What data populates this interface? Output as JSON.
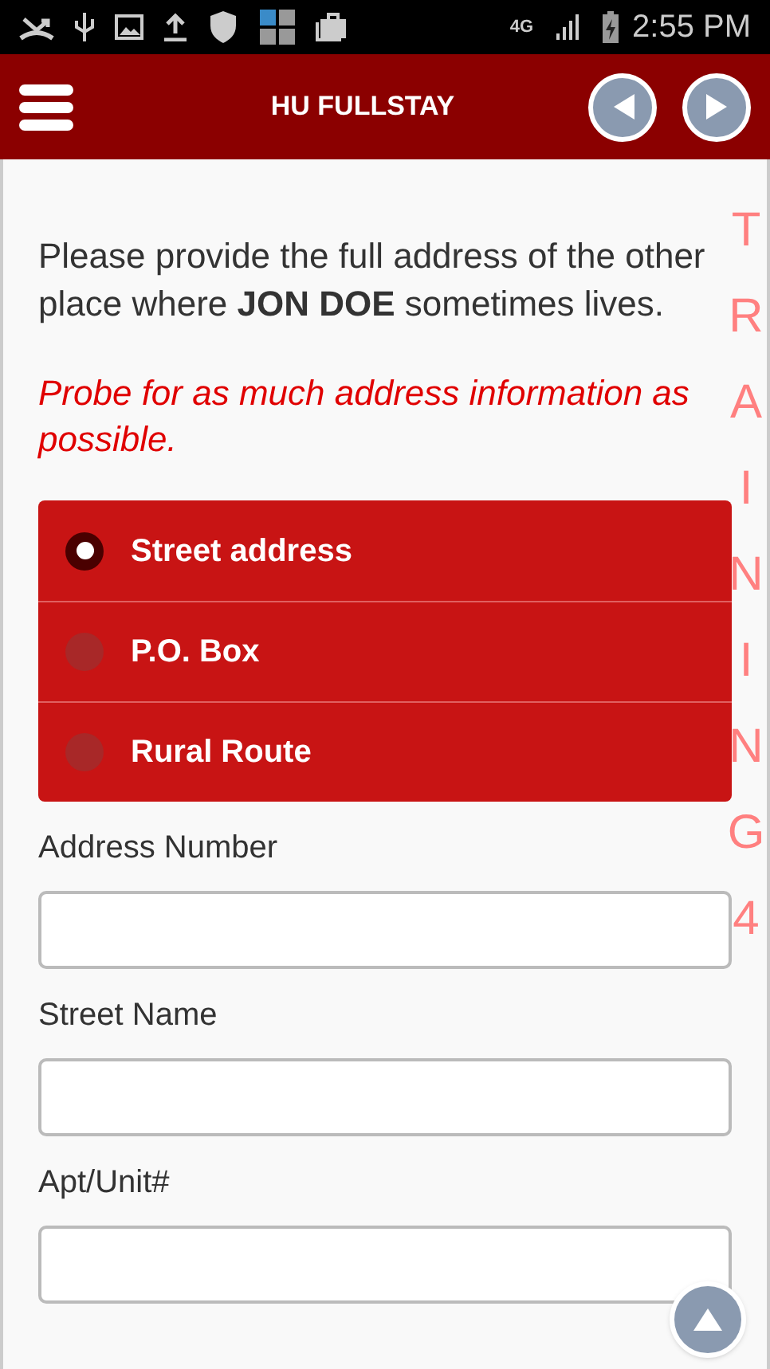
{
  "status_bar": {
    "network": "4G",
    "time": "2:55 PM"
  },
  "header": {
    "title": "HU FULLSTAY"
  },
  "question": "Please provide the full address of the other place where **JON DOE** sometimes lives.",
  "instruction": "Probe for as much address information as possible.",
  "options": [
    {
      "label": "Street address",
      "selected": true
    },
    {
      "label": "P.O. Box",
      "selected": false
    },
    {
      "label": "Rural Route",
      "selected": false
    }
  ],
  "fields": [
    {
      "label": "Address Number"
    },
    {
      "label": "Street Name"
    },
    {
      "label": "Apt/Unit#"
    }
  ],
  "overlay": "TRAINING4"
}
